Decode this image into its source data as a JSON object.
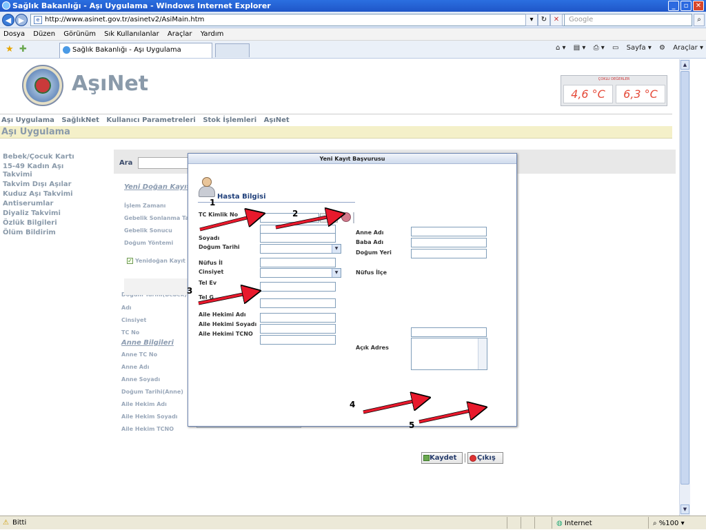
{
  "window": {
    "title": "Sağlık Bakanlığı - Aşı Uygulama - Windows Internet Explorer"
  },
  "browser": {
    "url": "http://www.asinet.gov.tr/asinetv2/AsiMain.htm",
    "search_placeholder": "Google",
    "menu": [
      "Dosya",
      "Düzen",
      "Görünüm",
      "Sık Kullanılanlar",
      "Araçlar",
      "Yardım"
    ],
    "tab_title": "Sağlık Bakanlığı - Aşı Uygulama",
    "tools": {
      "page": "Sayfa",
      "tools": "Araçlar"
    },
    "status": {
      "left": "Bitti",
      "zone": "Internet",
      "zoom": "%100"
    }
  },
  "page": {
    "brand": "AşıNet",
    "thermo": {
      "header": "ÇOKLU DEĞERLER",
      "t1": "4,6 °C",
      "t2": "6,3 °C"
    },
    "topnav": [
      "Aşı Uygulama",
      "SağlıkNet",
      "Kullanıcı Parametreleri",
      "Stok İşlemleri",
      "AşıNet"
    ],
    "page_title": "Aşı Uygulama",
    "sidenav": [
      "Bebek/Çocuk Kartı",
      "15-49 Kadın Aşı Takvimi",
      "Takvim Dışı Aşılar",
      "Kuduz Aşı Takvimi",
      "Antiserumlar",
      "Diyaliz Takvimi",
      "Özlük Bilgileri",
      "Ölüm Bildirim"
    ],
    "search_label": "Ara",
    "bg": {
      "section1": "Yeni Doğan Kayıt B",
      "f1": "İşlem Zamanı",
      "f2": "Gebelik Sonlanma Tarihi",
      "f3": "Gebelik Sonucu",
      "f4": "Doğum Yöntemi",
      "check": "Yenidoğan Kayıt",
      "g1": "Doğum Tarihi(Bebek)",
      "g2": "Adı",
      "g3": "Cinsiyet",
      "g4": "TC No",
      "section2": "Anne Bilgileri",
      "h1": "Anne TC No",
      "h2": "Anne Adı",
      "h3": "Anne Soyadı",
      "h4": "Doğum Tarihi(Anne)",
      "h5": "Aile Hekim Adı",
      "h6": "Aile Hekim Soyadı",
      "h7": "Aile Hekim TCNO"
    }
  },
  "modal": {
    "title": "Yeni Kayıt Başvurusu",
    "section": "Hasta Bilgisi",
    "labels": {
      "tc": "TC Kimlik No",
      "soyadi": "Soyadı",
      "dogum_tarihi": "Doğum Tarihi",
      "nufus_il": "Nüfus İl",
      "cinsiyet": "Cinsiyet",
      "tel_ev": "Tel Ev",
      "tel_gsm": "Tel G",
      "ah_adi": "Aile Hekimi Adı",
      "ah_soyadi": "Aile Hekimi Soyadı",
      "ah_tcno": "Aile Hekimi TCNO",
      "anne_adi": "Anne Adı",
      "baba_adi": "Baba Adı",
      "dogum_yeri": "Doğum Yeri",
      "nufus_ilce": "Nüfus İlçe",
      "acik_adres": "Açık Adres"
    },
    "save": "Kaydet",
    "exit": "Çıkış"
  },
  "annotations": [
    "1",
    "2",
    "3",
    "4",
    "5"
  ]
}
